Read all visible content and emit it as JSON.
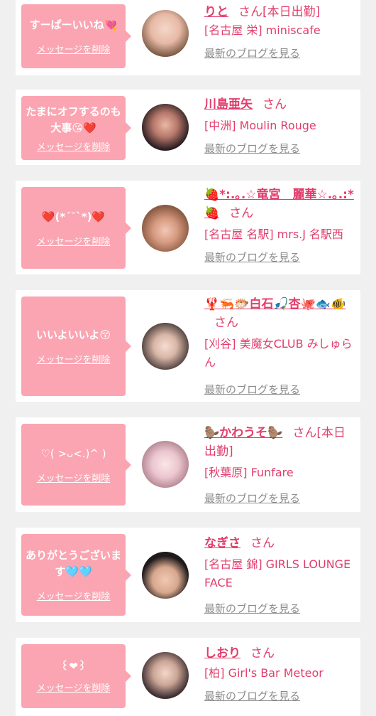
{
  "delete_label": "メッセージを削除",
  "san_label": "さん",
  "blog_label": "最新のブログを見る",
  "entries": [
    {
      "message": "すーぱーいいね💘",
      "name": "りと",
      "status": "[本日出勤]",
      "shop": "[名古屋 栄] miniscafe",
      "avatar_icon": "avatar-photo"
    },
    {
      "message": "たまにオフするのも大事😘❤️",
      "name": "川島亜矢",
      "status": "",
      "shop": "[中洲] Moulin Rouge",
      "avatar_icon": "avatar-photo"
    },
    {
      "message": "❤️(*´˘`*)❤️",
      "name": "🍓*:.｡.☆竜宮　麗華☆.｡.:*🍓",
      "status": "",
      "shop": "[名古屋 名駅] mrs.J 名駅西",
      "avatar_icon": "avatar-photo"
    },
    {
      "message": "いいよいいよ😚",
      "name": "🦞🦐🐡白石🎣杏🐙🐟🐠",
      "status": "",
      "shop": "[刈谷] 美魔女CLUB みしゅらん",
      "avatar_icon": "avatar-photo"
    },
    {
      "message": "♡( >ᴗ<.)^ )",
      "name": "🦫かわうそ🦫",
      "status": "[本日出勤]",
      "shop": "[秋葉原] Funfare",
      "avatar_icon": "avatar-photo"
    },
    {
      "message": "ありがとうございます🩵🩵",
      "name": "なぎさ",
      "status": "",
      "shop": "[名古屋 錦] GIRLS LOUNGE FACE",
      "avatar_icon": "avatar-photo"
    },
    {
      "message": "꒰❤︎꒱",
      "name": "しおり",
      "status": "",
      "shop": "[柏] Girl's Bar Meteor",
      "avatar_icon": "avatar-photo"
    }
  ]
}
